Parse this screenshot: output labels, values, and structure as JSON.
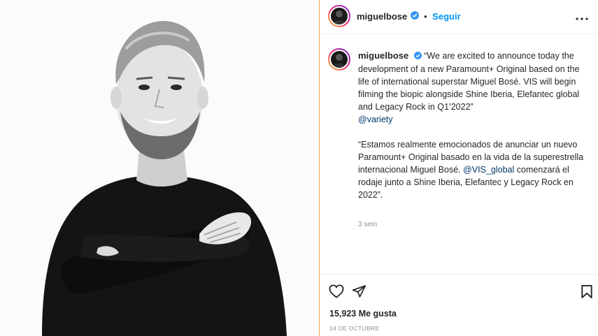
{
  "post": {
    "username": "miguelbose",
    "follow_label": "Seguir",
    "separator": "•",
    "caption_en": "“We are excited to announce today the development of a new Paramount+ Original based on the life of international superstar Miguel Bosé. VIS will begin filming the biopic alongside Shine Iberia, Elefantec global and Legacy Rock in Q1’2022”",
    "mention_variety": "@variety",
    "caption_es_part1": "“Estamos realmente emocionados de anunciar un nuevo Paramount+ Original basado en la vida de la superestrella internacional Miguel Bosé.",
    "mention_vis": "@VIS_global",
    "caption_es_part2": "comenzará el rodaje junto a Shine Iberia, Elefantec y Legacy Rock en 2022”.",
    "time_ago": "3 sem",
    "likes": "15,923 Me gusta",
    "date": "14 DE OCTUBRE"
  },
  "colors": {
    "follow": "#0095f6",
    "verified": "#3897f0",
    "link": "#00376b",
    "divider": "#f0a24a"
  },
  "icons": {
    "more": "more-options-icon",
    "like": "heart-icon",
    "share": "send-icon",
    "save": "bookmark-icon",
    "verified": "verified-badge-icon"
  }
}
